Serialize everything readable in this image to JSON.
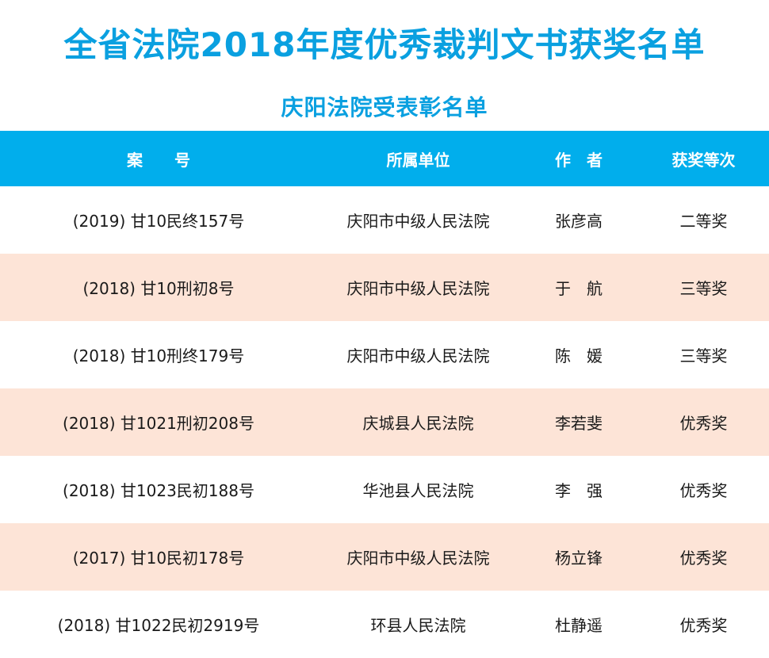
{
  "title": "全省法院2018年度优秀裁判文书获奖名单",
  "subtitle": "庆阳法院受表彰名单",
  "table": {
    "headers": [
      "案　　号",
      "所属单位",
      "作　者",
      "获奖等次"
    ],
    "rows": [
      [
        "(2019) 甘10民终157号",
        "庆阳市中级人民法院",
        "张彦高",
        "二等奖"
      ],
      [
        "(2018) 甘10刑初8号",
        "庆阳市中级人民法院",
        "于　航",
        "三等奖"
      ],
      [
        "(2018) 甘10刑终179号",
        "庆阳市中级人民法院",
        "陈　媛",
        "三等奖"
      ],
      [
        "(2018) 甘1021刑初208号",
        "庆城县人民法院",
        "李若斐",
        "优秀奖"
      ],
      [
        "(2018) 甘1023民初188号",
        "华池县人民法院",
        "李　强",
        "优秀奖"
      ],
      [
        "(2017) 甘10民初178号",
        "庆阳市中级人民法院",
        "杨立锋",
        "优秀奖"
      ],
      [
        "(2018) 甘1022民初2919号",
        "环县人民法院",
        "杜静遥",
        "优秀奖"
      ]
    ]
  },
  "colors": {
    "accent": "#0aa0e0",
    "header_bg": "#01aeec",
    "row_alt_bg": "#fde4d7"
  }
}
